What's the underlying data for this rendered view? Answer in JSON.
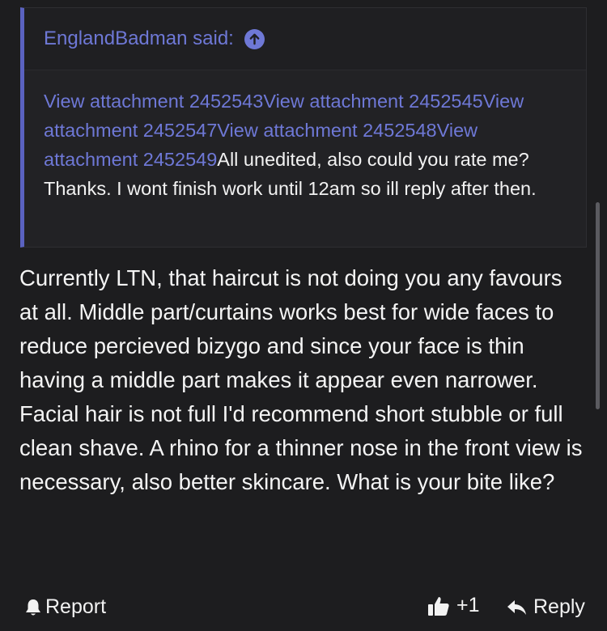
{
  "quote": {
    "author_said": "EnglandBadman said:",
    "attachments": [
      "View attachment 2452543",
      "View attachment 2452545",
      "View attachment 2452547",
      "View attachment 2452548",
      "View attachment 2452549"
    ],
    "text": "All unedited, also could you rate me? Thanks. I wont finish work until 12am so ill reply after then."
  },
  "post": {
    "text": "Currently LTN, that haircut is not doing you any favours at all. Middle part/curtains works best for wide faces to reduce percieved bizygo and since your face is thin having a middle part makes it appear even narrower. Facial hair is not full I'd recommend short stubble or full clean shave. A rhino for a thinner nose in the front view is necessary, also better skincare. What is your bite like?"
  },
  "footer": {
    "report_label": "Report",
    "like_label": "+1",
    "reply_label": "Reply"
  },
  "colors": {
    "background": "#1d1d1f",
    "quote_accent": "#5a62c0",
    "link": "#6e78d6",
    "text": "#f2f2f2"
  },
  "icons": {
    "jump_to_quote": "arrow-up-circle-icon",
    "report": "bell-icon",
    "like": "thumbs-up-icon",
    "reply": "reply-arrow-icon"
  }
}
